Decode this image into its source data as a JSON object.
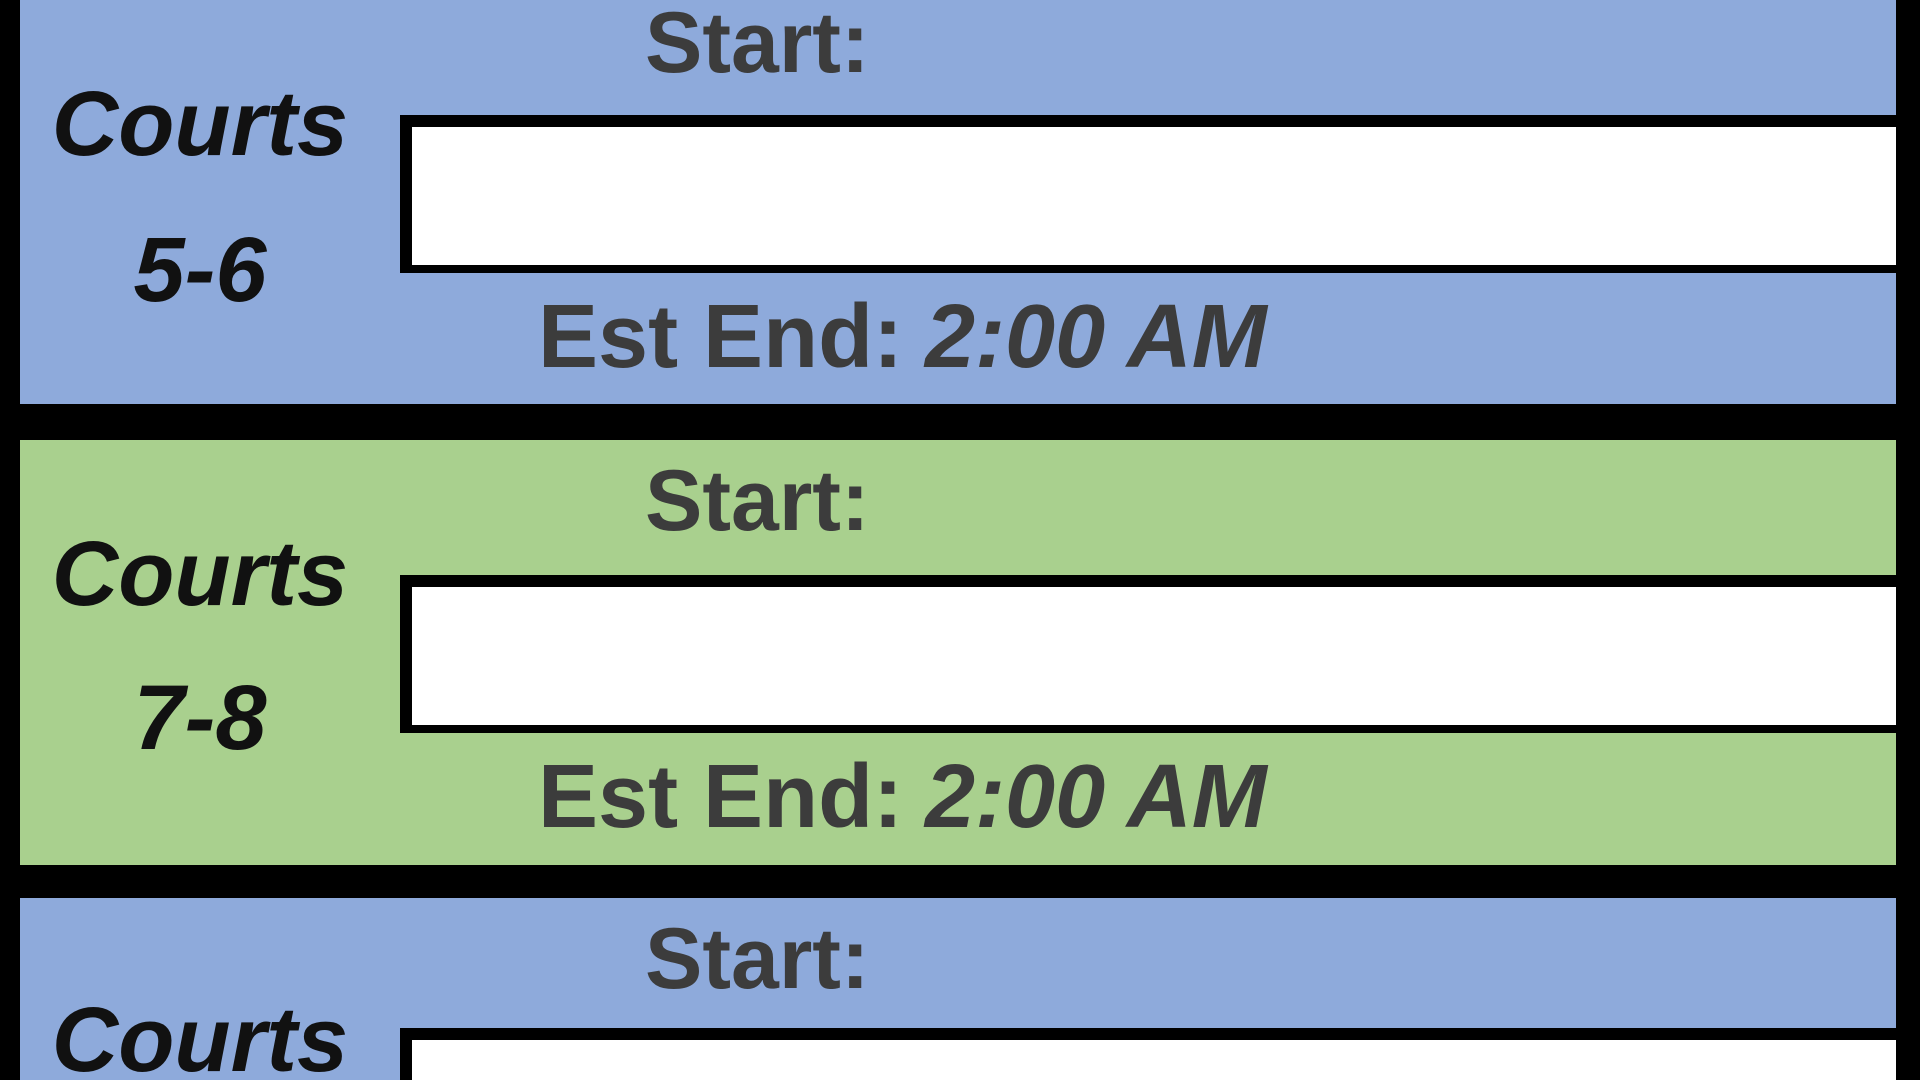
{
  "colors": {
    "blue_band": "#8eaadb",
    "green_band": "#a9d08e",
    "grid_line": "#000000",
    "label_text": "#3c3c3c",
    "courts_text": "#111111"
  },
  "rows": [
    {
      "courts_word": "Courts",
      "courts_range": "5-6",
      "start_label": "Start:",
      "start_value": "",
      "est_end_label": "Est End:",
      "est_end_value": "2:00 AM",
      "band_color": "#8eaadb"
    },
    {
      "courts_word": "Courts",
      "courts_range": "7-8",
      "start_label": "Start:",
      "start_value": "",
      "est_end_label": "Est End:",
      "est_end_value": "2:00 AM",
      "band_color": "#a9d08e"
    },
    {
      "courts_word": "Courts",
      "start_label": "Start:",
      "start_value": "",
      "band_color": "#8eaadb"
    }
  ]
}
